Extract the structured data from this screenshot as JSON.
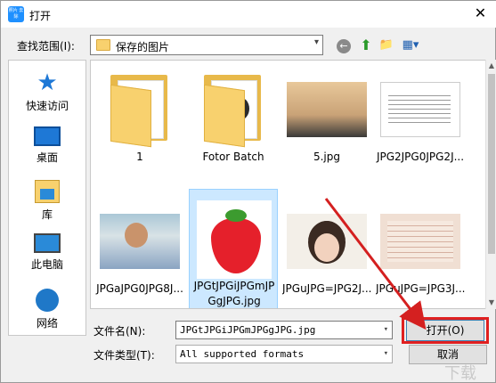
{
  "window": {
    "title": "打开",
    "app_icon_text": "照片 去除",
    "close_glyph": "✕"
  },
  "toolbar": {
    "look_in_label": "查找范围(I):",
    "look_in_value": "保存的图片"
  },
  "places": [
    {
      "label": "快速访问",
      "icon": "star-icon"
    },
    {
      "label": "桌面",
      "icon": "desktop-icon"
    },
    {
      "label": "库",
      "icon": "library-icon"
    },
    {
      "label": "此电脑",
      "icon": "computer-icon"
    },
    {
      "label": "网络",
      "icon": "network-icon"
    }
  ],
  "files": [
    {
      "name": "1",
      "kind": "folder"
    },
    {
      "name": "Fotor Batch",
      "kind": "folder"
    },
    {
      "name": "5.jpg",
      "kind": "image"
    },
    {
      "name": "JPG2JPG0JPG2J...",
      "kind": "image"
    },
    {
      "name": "JPGaJPG0JPG8J...",
      "kind": "image"
    },
    {
      "name": "JPGtJPGiJPGmJPGgJPG.jpg",
      "kind": "image",
      "selected": true
    },
    {
      "name": "JPGuJPG=JPG2J...",
      "kind": "image"
    },
    {
      "name": "JPGuJPG=JPG3J...",
      "kind": "image"
    }
  ],
  "footer": {
    "filename_label": "文件名(N):",
    "filename_value": "JPGtJPGiJPGmJPGgJPG.jpg",
    "filetype_label": "文件类型(T):",
    "filetype_value": "All supported formats",
    "open_label": "打开(O)",
    "cancel_label": "取消"
  },
  "colors": {
    "highlight": "#e02020",
    "selection": "#cce8ff"
  }
}
